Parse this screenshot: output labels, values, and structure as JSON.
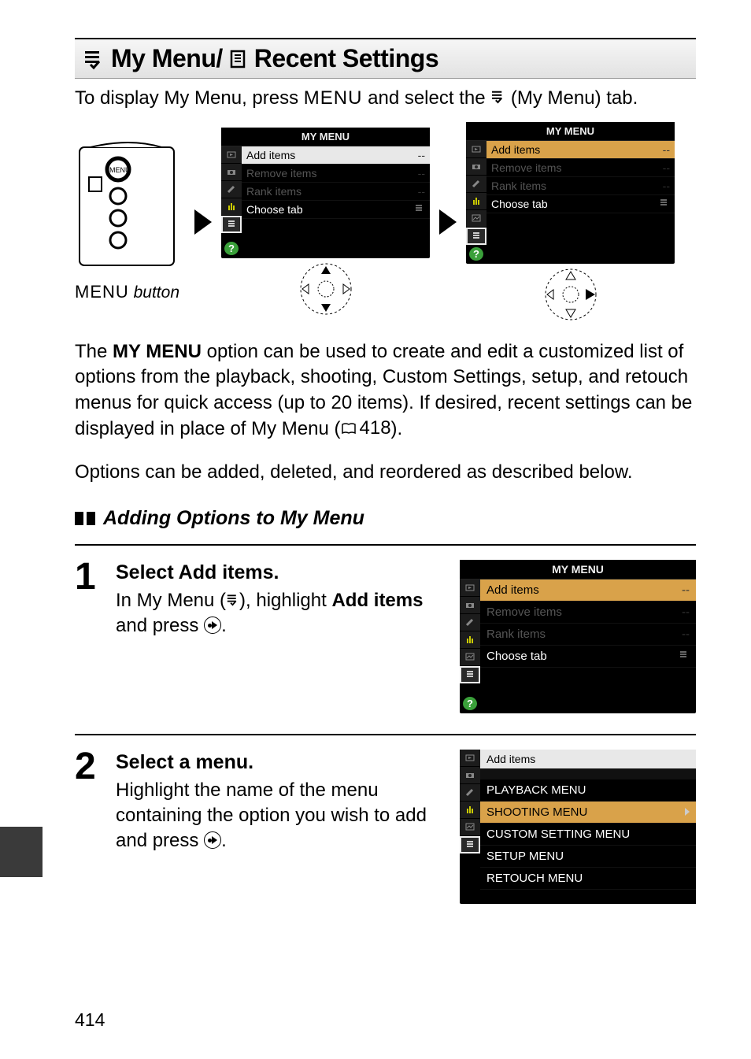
{
  "title": {
    "part1": "My Menu/",
    "part2": "Recent Settings"
  },
  "intro": {
    "pre": "To display My Menu, press ",
    "menu_word": "MENU",
    "mid": " and select the ",
    "post": " (My Menu) tab."
  },
  "menu_button_caption": {
    "menu_word": "MENU",
    "rest": " button"
  },
  "para1": {
    "pre": "The ",
    "bold": "MY MENU",
    "rest_a": " option can be used to create and edit a customized list of options from the playback, shooting, Custom Settings, setup, and retouch menus for quick access (up to 20 items).  If desired, recent settings can be displayed in place of My Menu (",
    "page_ref": "418",
    "rest_b": ")."
  },
  "para2": "Options can be added, deleted, and reordered as described below.",
  "subhead": "Adding Options to My Menu",
  "steps": [
    {
      "num": "1",
      "title": "Select Add items.",
      "desc_pre": "In My Menu (",
      "desc_mid": "), highlight ",
      "desc_bold": "Add items",
      "desc_post": " and press ",
      "desc_end": "."
    },
    {
      "num": "2",
      "title": "Select a menu.",
      "desc": "Highlight the name of the menu containing the option you wish to add and press ",
      "desc_end": "."
    }
  ],
  "screens": {
    "mymenu_title": "MY MENU",
    "rows": {
      "add": {
        "label": "Add items",
        "value": "--"
      },
      "remove": {
        "label": "Remove items",
        "value": "--"
      },
      "rank": {
        "label": "Rank items",
        "value": "--"
      },
      "choose": {
        "label": "Choose tab",
        "value_icon": true
      }
    },
    "additems_screen": {
      "header": "Add items",
      "items": [
        "PLAYBACK MENU",
        "SHOOTING MENU",
        "CUSTOM SETTING MENU",
        "SETUP MENU",
        "RETOUCH MENU"
      ],
      "highlight_index": 1
    }
  },
  "page_number": "414"
}
